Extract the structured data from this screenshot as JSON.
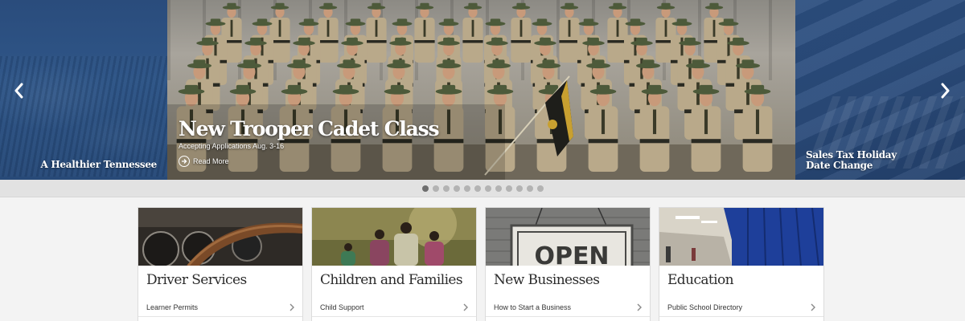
{
  "carousel": {
    "left_slide": {
      "caption": "A Healthier Tennessee"
    },
    "main_slide": {
      "title": "New Trooper Cadet Class",
      "subtitle": "Accepting Applications Aug. 3-16",
      "read_more": "Read More"
    },
    "right_slide": {
      "caption_line1": "Sales Tax Holiday",
      "caption_line2": "Date Change"
    },
    "dots": {
      "count": 12,
      "active_index": 0
    }
  },
  "cards": [
    {
      "title": "Driver Services",
      "link": "Learner Permits",
      "image": "dashboard-steering-wheel-photo"
    },
    {
      "title": "Children and Families",
      "link": "Child Support",
      "image": "family-walking-photo"
    },
    {
      "title": "New Businesses",
      "link": "How to Start a Business",
      "image": "open-sign-photo"
    },
    {
      "title": "Education",
      "link": "Public School Directory",
      "image": "school-hallway-lockers-photo"
    }
  ],
  "colors": {
    "slide_blue": "#2a4c7c",
    "dots_bar": "#e2e2e2",
    "dot_active": "#6e6e6e",
    "dot_inactive": "#b3b3b3",
    "card_title": "#2b2b2b"
  }
}
